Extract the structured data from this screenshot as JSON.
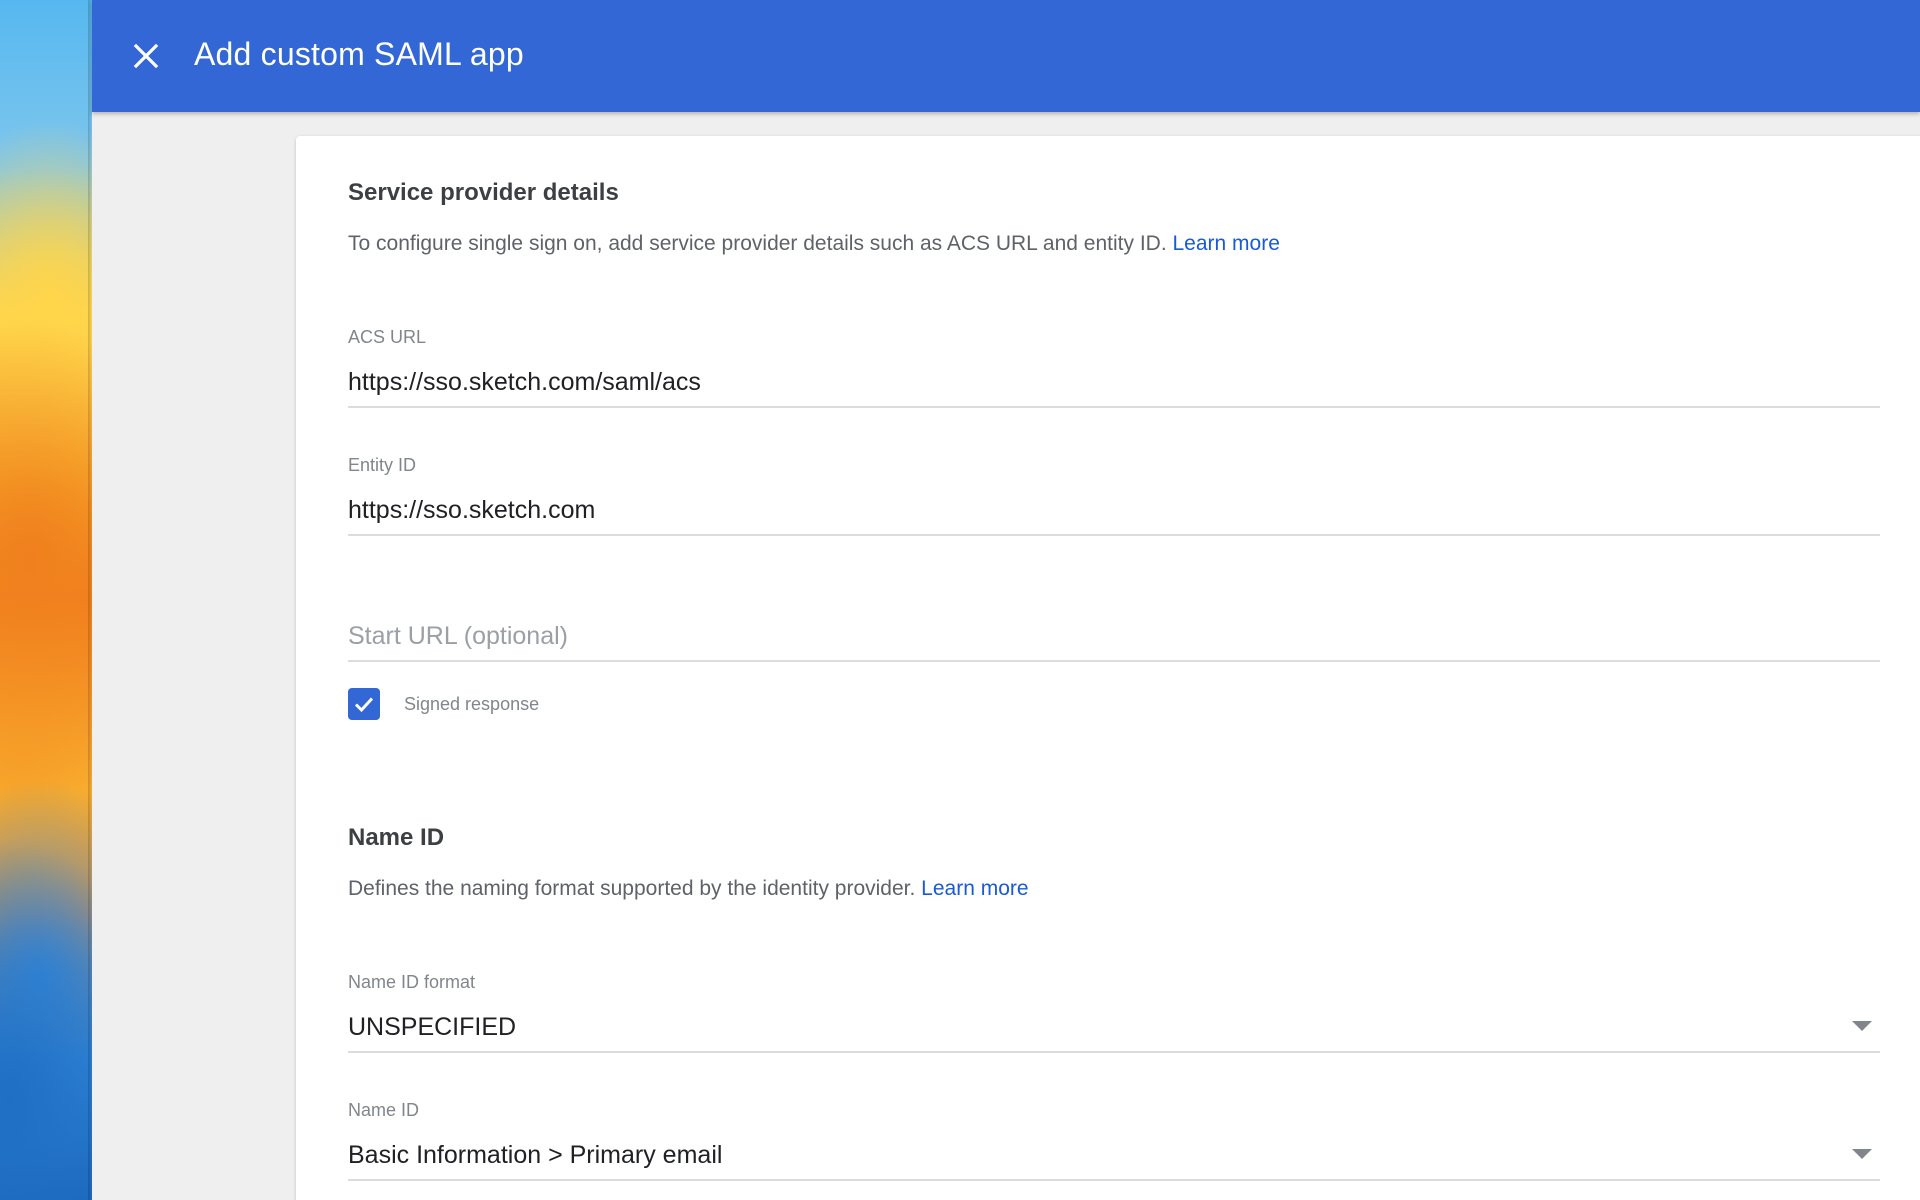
{
  "header": {
    "title": "Add custom SAML app",
    "close_icon": "close-icon"
  },
  "service_provider": {
    "title": "Service provider details",
    "description": "To configure single sign on, add service provider details such as ACS URL and entity ID.",
    "learn_more": "Learn more",
    "acs_url": {
      "label": "ACS URL",
      "value": "https://sso.sketch.com/saml/acs"
    },
    "entity_id": {
      "label": "Entity ID",
      "value": "https://sso.sketch.com"
    },
    "start_url": {
      "placeholder": "Start URL (optional)",
      "value": ""
    },
    "signed_response": {
      "label": "Signed response",
      "checked": true
    }
  },
  "name_id": {
    "title": "Name ID",
    "description": "Defines the naming format supported by the identity provider.",
    "learn_more": "Learn more",
    "format": {
      "label": "Name ID format",
      "value": "UNSPECIFIED"
    },
    "name_id": {
      "label": "Name ID",
      "value": "Basic Information > Primary email"
    }
  },
  "colors": {
    "header": "#3367d6",
    "link": "#1a5ad7",
    "checkbox": "#3367d6"
  }
}
